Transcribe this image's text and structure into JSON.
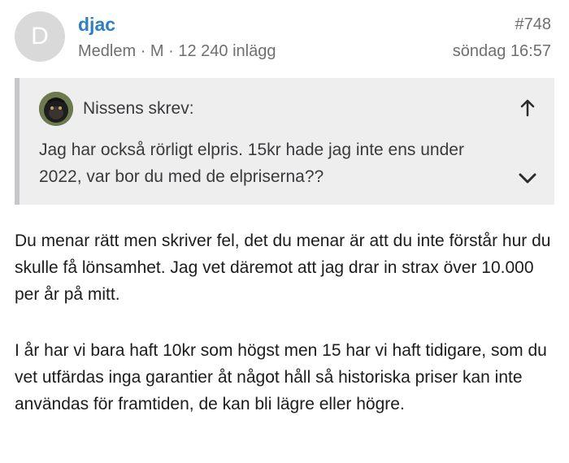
{
  "post": {
    "avatar_letter": "D",
    "author": "djac",
    "meta": "Medlem · M · 12 240 inlägg",
    "number": "#748",
    "time": "söndag 16:57"
  },
  "quote": {
    "author_label": "Nissens skrev:",
    "text": "Jag har också rörligt elpris. 15kr hade jag inte ens under 2022, var bor du med de elpriserna??",
    "up_icon": "arrow-up-icon",
    "expand_icon": "chevron-down-icon"
  },
  "body": {
    "paragraph_1": "Du menar rätt men skriver fel, det du menar är att du inte förstår hur du skulle få lönsamhet. Jag vet däremot att jag drar in strax över 10.000 per år på mitt.",
    "paragraph_2": "I år har vi bara haft 10kr som högst men 15 har vi haft tidigare, som du vet utfärdas inga garantier åt något håll så historiska priser kan inte användas för framtiden, de kan bli lägre eller högre."
  },
  "colors": {
    "author": "#2f7fc0",
    "meta": "#6f6f72",
    "quote_bg": "#eeeeef",
    "quote_border": "#c7c7cb"
  }
}
